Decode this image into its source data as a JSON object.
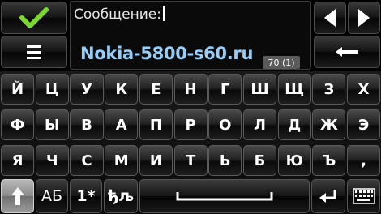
{
  "message": {
    "label": "Сообщение:",
    "watermark": "Nokia-5800-s60.ru",
    "counter": "70 (1)"
  },
  "toolbar": {
    "ok": "ok-check-icon",
    "menu": "menu-lines-icon",
    "left": "arrow-left-icon",
    "right": "arrow-right-icon",
    "backspace": "backspace-arrow-icon"
  },
  "keyboard": {
    "row1": [
      "Й",
      "Ц",
      "У",
      "К",
      "Е",
      "Н",
      "Г",
      "Ш",
      "Щ",
      "З",
      "Х"
    ],
    "row2": [
      "Ф",
      "Ы",
      "В",
      "А",
      "П",
      "Р",
      "О",
      "Л",
      "Д",
      "Ж",
      "Э"
    ],
    "row3": [
      "Я",
      "Ч",
      "С",
      "М",
      "И",
      "Т",
      "Ь",
      "Б",
      "Ю",
      "Ъ",
      ","
    ]
  },
  "bottom": {
    "shift": "shift-arrow-icon",
    "case_label": "АБ",
    "num_label": "1*",
    "lang_label": "ђљ",
    "space": "space-bar-icon",
    "enter": "enter-icon",
    "layout": "keyboard-grid-icon"
  }
}
